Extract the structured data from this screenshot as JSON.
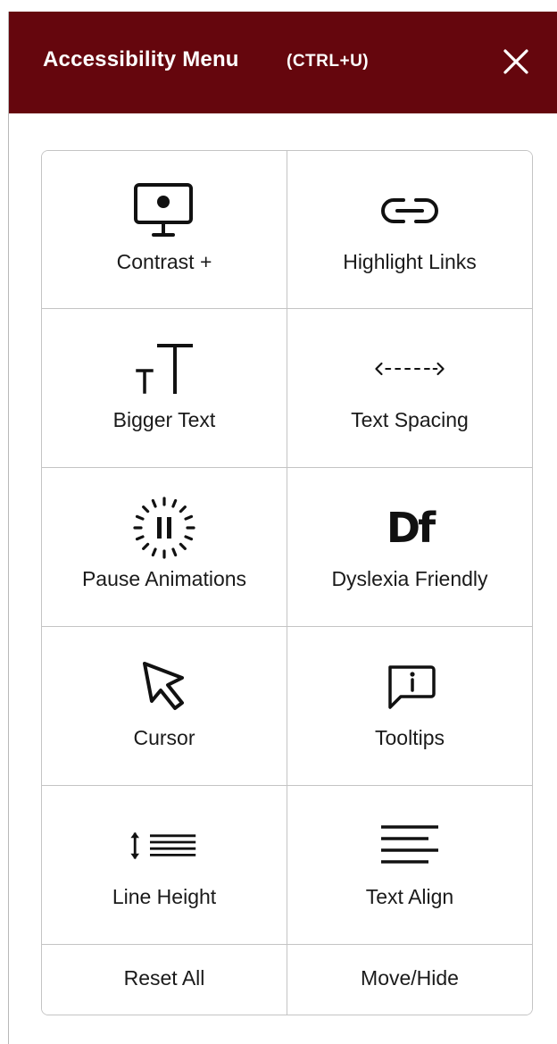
{
  "header": {
    "title": "Accessibility Menu",
    "shortcut": "(CTRL+U)",
    "background_color": "#65060d",
    "close_icon": "close-icon"
  },
  "tiles": [
    {
      "label": "Contrast +",
      "icon": "monitor-contrast-icon"
    },
    {
      "label": "Highlight Links",
      "icon": "link-icon"
    },
    {
      "label": "Bigger Text",
      "icon": "text-size-icon"
    },
    {
      "label": "Text Spacing",
      "icon": "spacing-arrows-icon"
    },
    {
      "label": "Pause Animations",
      "icon": "pause-circle-icon"
    },
    {
      "label": "Dyslexia Friendly",
      "icon": "dyslexia-df-icon",
      "glyph": "Df"
    },
    {
      "label": "Cursor",
      "icon": "cursor-arrow-icon"
    },
    {
      "label": "Tooltips",
      "icon": "tooltip-info-icon"
    },
    {
      "label": "Line Height",
      "icon": "line-height-icon"
    },
    {
      "label": "Text Align",
      "icon": "text-align-icon"
    }
  ],
  "footer": {
    "reset_label": "Reset All",
    "move_label": "Move/Hide"
  }
}
